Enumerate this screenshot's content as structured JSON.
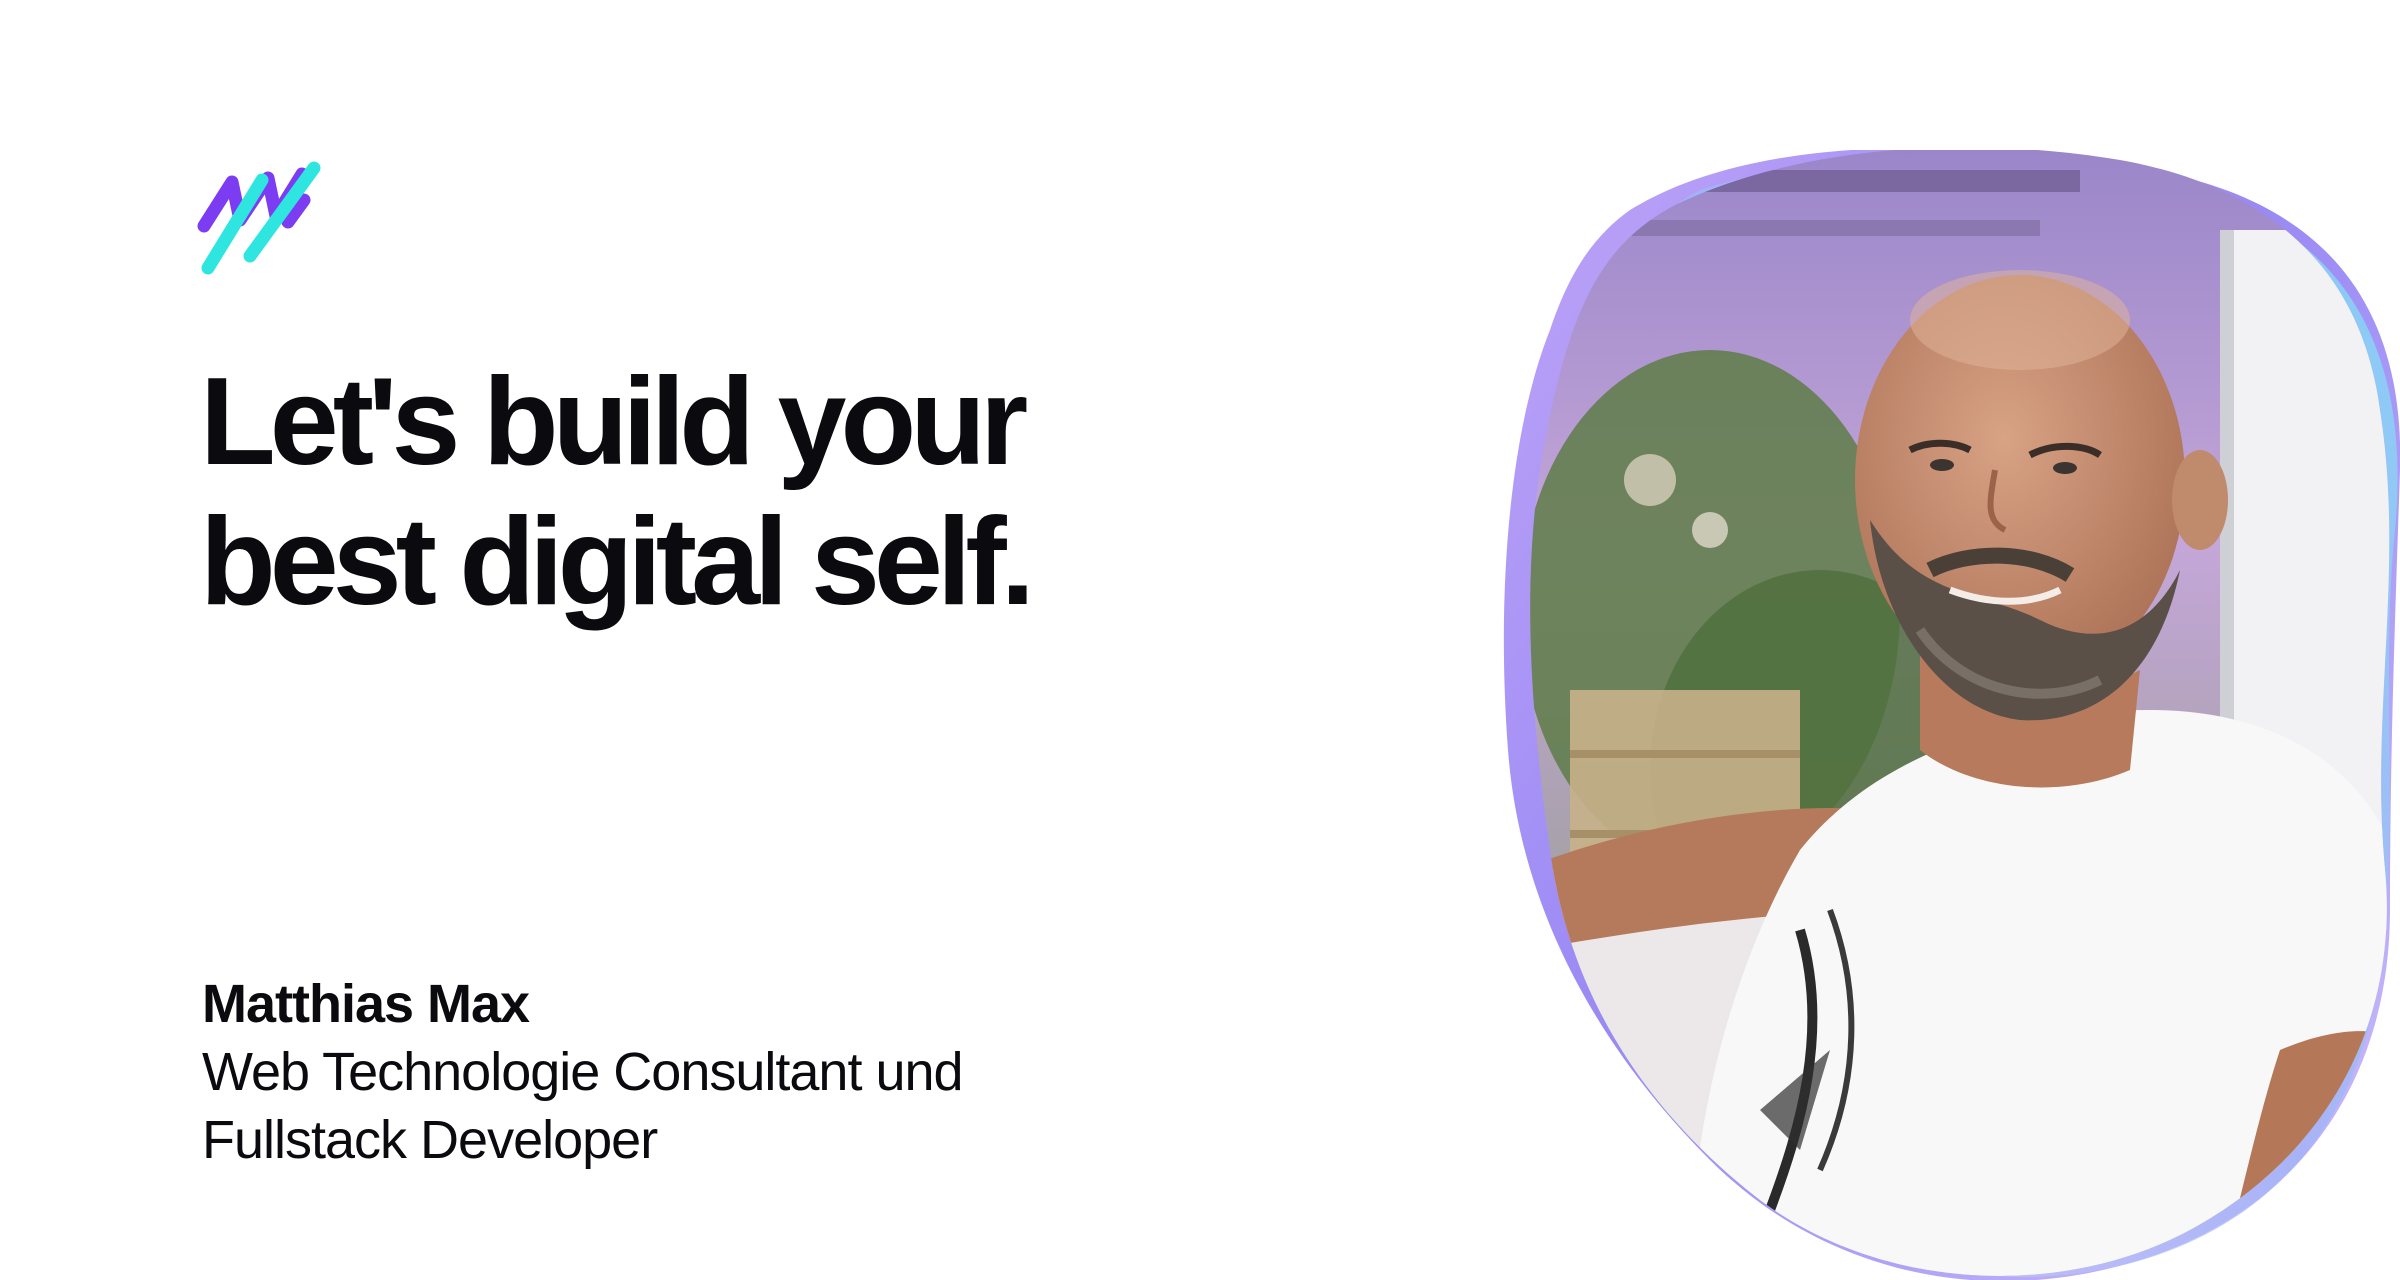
{
  "headline": {
    "line1": "Let's build your",
    "line2": "best digital self."
  },
  "author": {
    "name": "Matthias Max",
    "role_line1": "Web Technologie Consultant und",
    "role_line2": "Fullstack Developer"
  },
  "colors": {
    "text": "#0b0b0f",
    "brand_violet": "#7b3cf2",
    "brand_cyan": "#2ee6df",
    "blob_purple": "#a98af5",
    "blob_cyan": "#6fe3f3"
  },
  "icons": {
    "logo": "brand-logo-icon",
    "portrait": "portrait-photo"
  }
}
